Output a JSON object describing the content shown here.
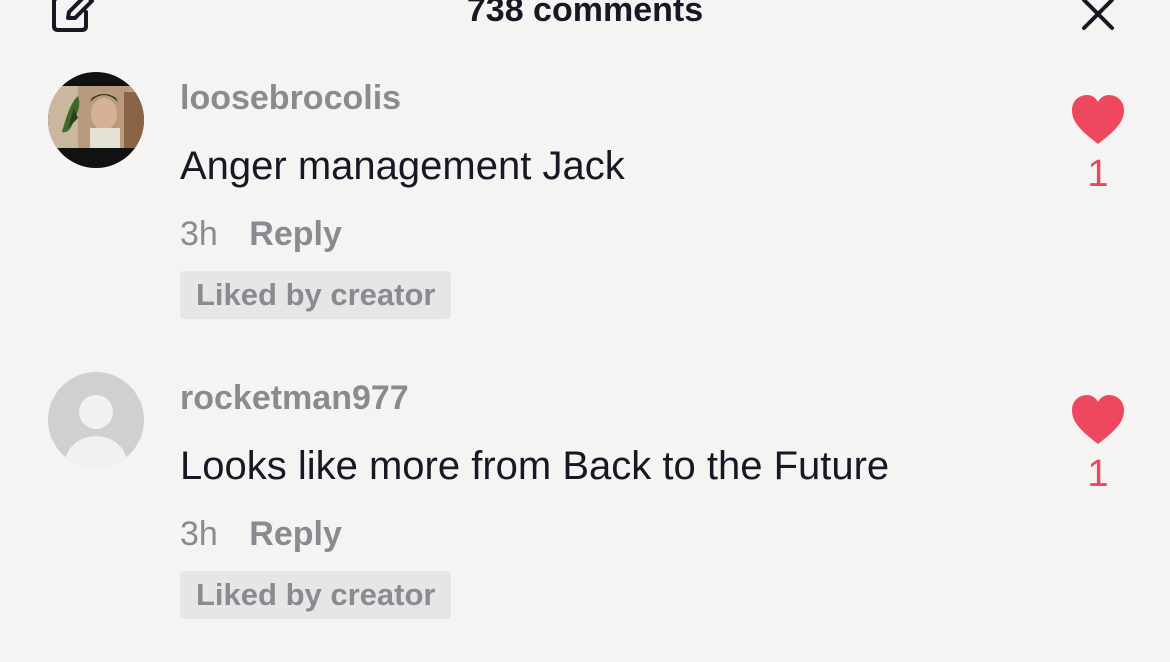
{
  "header": {
    "title": "738 comments",
    "edit_icon": "edit-icon",
    "close_icon": "close-icon"
  },
  "comments": [
    {
      "username": "loosebrocolis",
      "text": "Anger management Jack",
      "time": "3h",
      "reply_label": "Reply",
      "badge": "Liked by creator",
      "likes": "1",
      "avatar": "photo"
    },
    {
      "username": "rocketman977",
      "text": "Looks like more from Back to the Future",
      "time": "3h",
      "reply_label": "Reply",
      "badge": "Liked by creator",
      "likes": "1",
      "avatar": "default"
    }
  ],
  "colors": {
    "background": "#f5f4f3",
    "text_primary": "#161823",
    "text_secondary": "#8a8b91",
    "like": "#e8475f",
    "badge_bg": "#e6e6e6"
  }
}
